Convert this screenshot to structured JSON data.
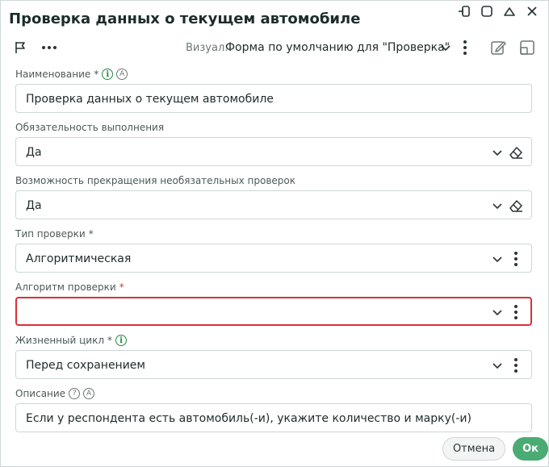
{
  "window": {
    "title": "Проверка данных о текущем автомобиле"
  },
  "toolbar": {
    "visual_label": "Визуал:",
    "visual_value": "Форма по умолчанию для \"Проверка\""
  },
  "fields": {
    "name": {
      "label": "Наименование",
      "required_mark": "*",
      "info_glyph": "i",
      "auto_glyph": "A",
      "value": "Проверка данных о текущем автомобиле"
    },
    "mandatory": {
      "label": "Обязательность выполнения",
      "value": "Да"
    },
    "stop_optional": {
      "label": "Возможность прекращения необязательных проверок",
      "value": "Да"
    },
    "check_type": {
      "label": "Тип проверки",
      "required_mark": "*",
      "value": "Алгоритмическая"
    },
    "algorithm": {
      "label": "Алгоритм проверки",
      "required_mark": "*",
      "value": ""
    },
    "lifecycle": {
      "label": "Жизненный цикл",
      "required_mark": "*",
      "info_glyph": "i",
      "value": "Перед сохранением"
    },
    "description": {
      "label": "Описание",
      "help_glyph": "?",
      "auto_glyph": "A",
      "value": "Если у респондента есть автомобиль(-и), укажите количество и марку(-и)"
    }
  },
  "footer": {
    "cancel_label": "Отмена",
    "ok_label": "Ок"
  },
  "colors": {
    "accent_green": "#4bab74",
    "error_red": "#d9303a",
    "info_green": "#1e8a3e"
  },
  "icons": {
    "window": [
      "pin-icon",
      "maximize-icon",
      "collapse-icon",
      "close-icon"
    ],
    "toolbar": [
      "flag-icon",
      "more-horizontal-icon",
      "chevron-down-icon",
      "more-vertical-icon",
      "edit-icon",
      "layout-icon"
    ]
  }
}
